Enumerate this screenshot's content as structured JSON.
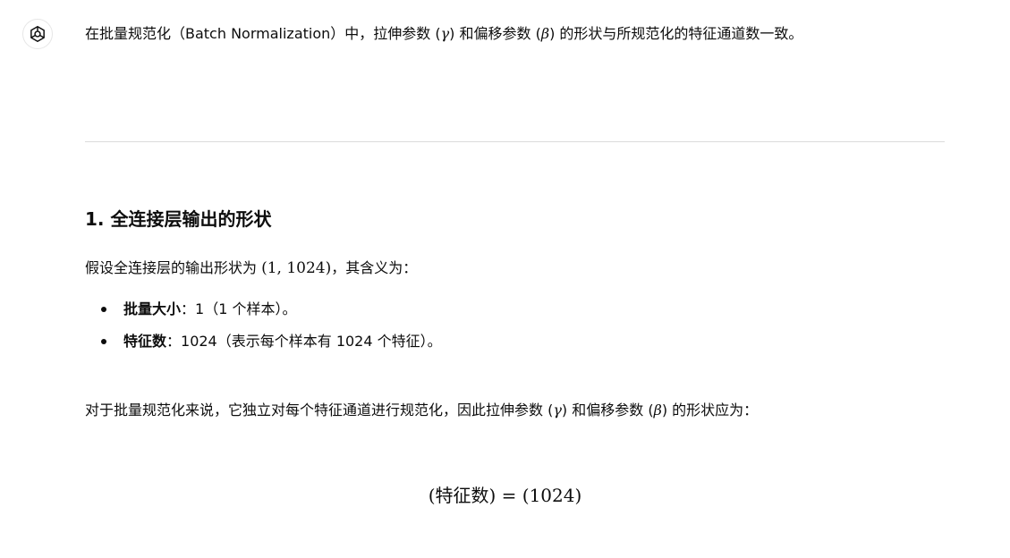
{
  "assistant": {
    "avatar_icon": "openai-logo-icon"
  },
  "intro": {
    "text_before_gamma": "在批量规范化（Batch Normalization）中，拉伸参数 (",
    "gamma": "γ",
    "text_between": ") 和偏移参数 (",
    "beta": "β",
    "text_after": ") 的形状与所规范化的特征通道数一致。"
  },
  "section": {
    "heading": "1. 全连接层输出的形状",
    "p1_before": "假设全连接层的输出形状为 ",
    "p1_math": "(1, 1024)",
    "p1_after": "，其含义为：",
    "bullets": [
      {
        "label": "批量大小",
        "text": "：1（1 个样本）。"
      },
      {
        "label": "特征数",
        "text": "：1024（表示每个样本有 1024 个特征）。"
      }
    ],
    "p2_before_gamma": "对于批量规范化来说，它独立对每个特征通道进行规范化，因此拉伸参数 (",
    "p2_gamma": "γ",
    "p2_between": ") 和偏移参数 (",
    "p2_beta": "β",
    "p2_after": ") 的形状应为：",
    "formula": "(特征数) = (1024)"
  },
  "colors": {
    "text": "#0d0d0d",
    "divider": "#dcdcdc"
  }
}
